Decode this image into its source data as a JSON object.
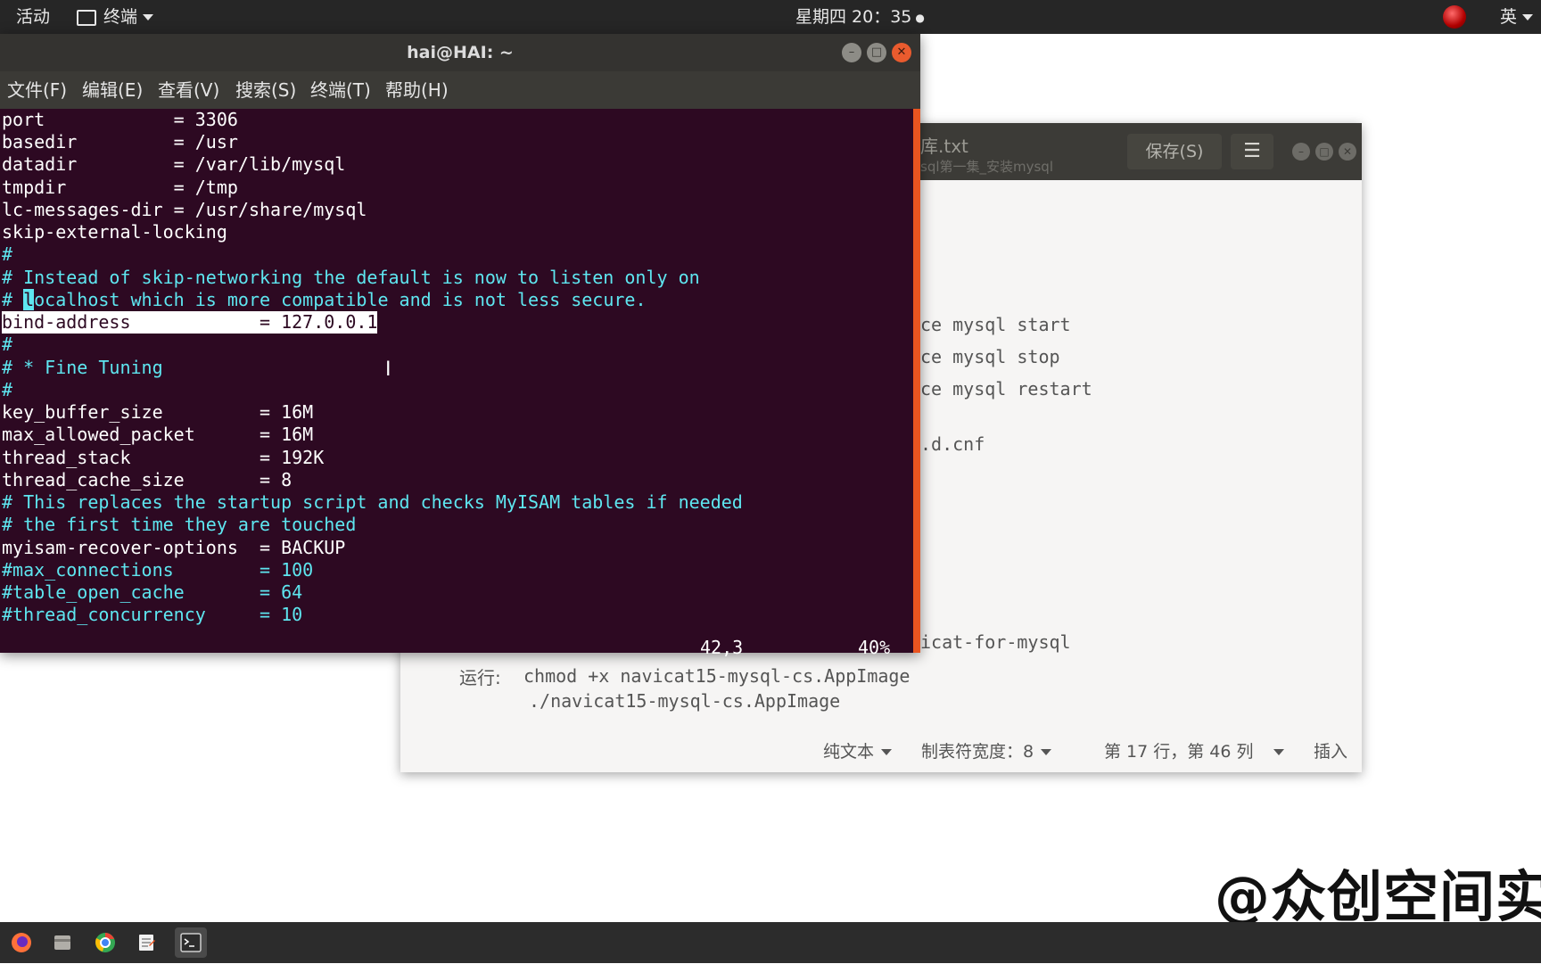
{
  "topbar": {
    "activities": "活动",
    "app_menu": "终端",
    "clock": "星期四 20：35",
    "clock_dot": "●",
    "input_method": "英"
  },
  "terminal": {
    "title": "hai@HAI: ~",
    "menu": [
      "文件(F)",
      "编辑(E)",
      "查看(V)",
      "搜索(S)",
      "终端(T)",
      "帮助(H)"
    ],
    "lines": [
      "port            = 3306",
      "basedir         = /usr",
      "datadir         = /var/lib/mysql",
      "tmpdir          = /tmp",
      "lc-messages-dir = /usr/share/mysql",
      "skip-external-locking",
      "#",
      "# Instead of skip-networking the default is now to listen only on",
      "# localhost which is more compatible and is not less secure.",
      "bind-address            = 127.0.0.1",
      "#",
      "# * Fine Tuning",
      "#",
      "key_buffer_size         = 16M",
      "max_allowed_packet      = 16M",
      "thread_stack            = 192K",
      "thread_cache_size       = 8",
      "# This replaces the startup script and checks MyISAM tables if needed",
      "# the first time they are touched",
      "myisam-recover-options  = BACKUP",
      "#max_connections        = 100",
      "#table_open_cache       = 64",
      "#thread_concurrency     = 10"
    ],
    "line_7_prefix": "# ",
    "line_7_cursor_char": "l",
    "line_7_rest": "ocalhost which is more compatible and is not less secure.",
    "cursor_position": "42,3",
    "scroll_percent": "40%"
  },
  "gedit": {
    "title": "库.txt",
    "subtitle": "sql第一集_安装mysql",
    "save_label": "保存(S)",
    "menu_icon": "hamburger-menu-icon",
    "visible_lines": [
      "ce mysql start",
      "ce mysql stop",
      "ce mysql restart",
      ".d.cnf",
      "icat-for-mysql"
    ],
    "run_label": "运行:",
    "run_cmd_1": "chmod +x navicat15-mysql-cs.AppImage",
    "run_cmd_2": "./navicat15-mysql-cs.AppImage",
    "status": {
      "syntax": "纯文本",
      "tab_width": "制表符宽度：8",
      "position": "第 17 行，第 46 列",
      "mode": "插入"
    }
  },
  "watermark": "@众创空间实",
  "taskbar": [
    "firefox-icon",
    "files-icon",
    "chrome-icon",
    "text-editor-icon",
    "terminal-icon"
  ],
  "colors": {
    "terminal_bg": "#2d0922",
    "comment_cyan": "#5ee6f0",
    "accent_orange": "#e95420"
  }
}
